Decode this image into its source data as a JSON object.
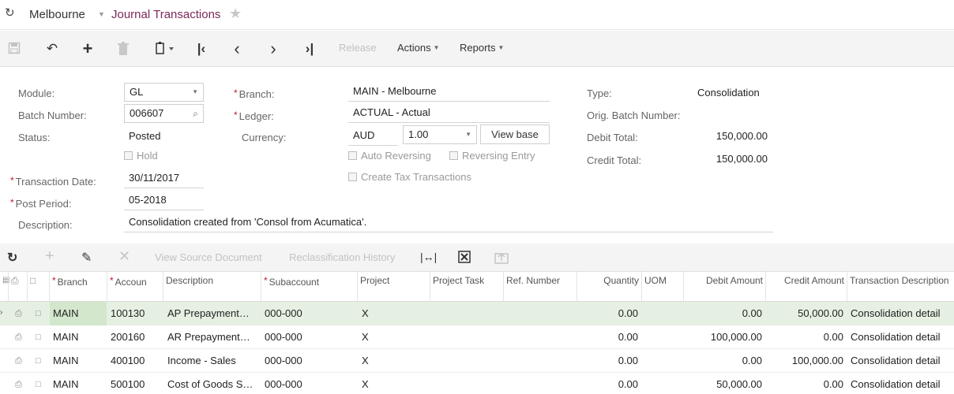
{
  "titlebar": {
    "company": "Melbourne",
    "screen_title": "Journal Transactions"
  },
  "toolbar": {
    "release_label": "Release",
    "actions_label": "Actions",
    "reports_label": "Reports"
  },
  "form": {
    "module_label": "Module:",
    "module_value": "GL",
    "batch_label": "Batch Number:",
    "batch_value": "006607",
    "status_label": "Status:",
    "status_value": "Posted",
    "hold_label": "Hold",
    "tran_date_label": "Transaction Date:",
    "tran_date_value": "30/11/2017",
    "post_period_label": "Post Period:",
    "post_period_value": "05-2018",
    "description_label": "Description:",
    "description_value": "Consolidation created from 'Consol from Acumatica'.",
    "branch_label": "Branch:",
    "branch_value": "MAIN - Melbourne",
    "ledger_label": "Ledger:",
    "ledger_value": "ACTUAL - Actual",
    "currency_label": "Currency:",
    "currency_value": "AUD",
    "rate_value": "1.00",
    "view_base_label": "View base",
    "auto_reversing_label": "Auto Reversing",
    "reversing_entry_label": "Reversing Entry",
    "create_tax_label": "Create Tax Transactions",
    "type_label": "Type:",
    "type_value": "Consolidation",
    "orig_batch_label": "Orig. Batch Number:",
    "debit_total_label": "Debit Total:",
    "debit_total_value": "150,000.00",
    "credit_total_label": "Credit Total:",
    "credit_total_value": "150,000.00"
  },
  "grid_toolbar": {
    "view_source_label": "View Source Document",
    "reclass_label": "Reclassification History"
  },
  "grid": {
    "headers": {
      "branch": "Branch",
      "account": "Accoun",
      "description": "Description",
      "subaccount": "Subaccount",
      "project": "Project",
      "project_task": "Project Task",
      "ref_number": "Ref. Number",
      "quantity": "Quantity",
      "uom": "UOM",
      "debit": "Debit Amount",
      "credit": "Credit Amount",
      "tran_desc": "Transaction Description"
    },
    "rows": [
      {
        "branch": "MAIN",
        "account": "100130",
        "description": "AP Prepayment…",
        "subaccount": "000-000",
        "project": "X",
        "quantity": "0.00",
        "debit": "0.00",
        "credit": "50,000.00",
        "tran_desc": "Consolidation detail"
      },
      {
        "branch": "MAIN",
        "account": "200160",
        "description": "AR Prepayment…",
        "subaccount": "000-000",
        "project": "X",
        "quantity": "0.00",
        "debit": "100,000.00",
        "credit": "0.00",
        "tran_desc": "Consolidation detail"
      },
      {
        "branch": "MAIN",
        "account": "400100",
        "description": "Income - Sales",
        "subaccount": "000-000",
        "project": "X",
        "quantity": "0.00",
        "debit": "0.00",
        "credit": "100,000.00",
        "tran_desc": "Consolidation detail"
      },
      {
        "branch": "MAIN",
        "account": "500100",
        "description": "Cost of Goods S…",
        "subaccount": "000-000",
        "project": "X",
        "quantity": "0.00",
        "debit": "50,000.00",
        "credit": "0.00",
        "tran_desc": "Consolidation detail"
      }
    ]
  }
}
